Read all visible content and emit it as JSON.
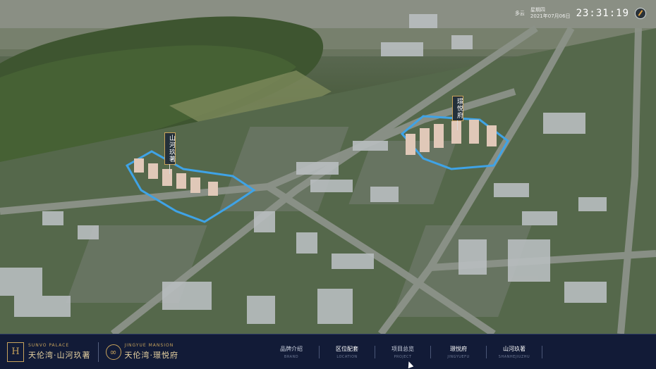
{
  "hud": {
    "weather": "多云",
    "date": "2021年07月06日",
    "weekday": "星期四",
    "time": "23:31:19"
  },
  "markers": {
    "shanhe": "山河玖著",
    "liyue": "璟悦府"
  },
  "brand1": {
    "en": "SUNVO PALACE",
    "cn": "天伦湾·山河玖著"
  },
  "brand2": {
    "en": "JINGYUE MANSION",
    "cn": "天伦湾·璟悦府"
  },
  "nav": [
    {
      "cn": "品牌介绍",
      "en": "BRAND"
    },
    {
      "cn": "区位配套",
      "en": "LOCATION"
    },
    {
      "cn": "项目总览",
      "en": "PROJECT"
    },
    {
      "cn": "璟悦府",
      "en": "JINGYUEFU"
    },
    {
      "cn": "山河玖著",
      "en": "SHANHEJIUZHU"
    }
  ],
  "colors": {
    "bar_bg": "#121b37",
    "gold": "#c8a35c",
    "river": "#3fa3e6"
  }
}
